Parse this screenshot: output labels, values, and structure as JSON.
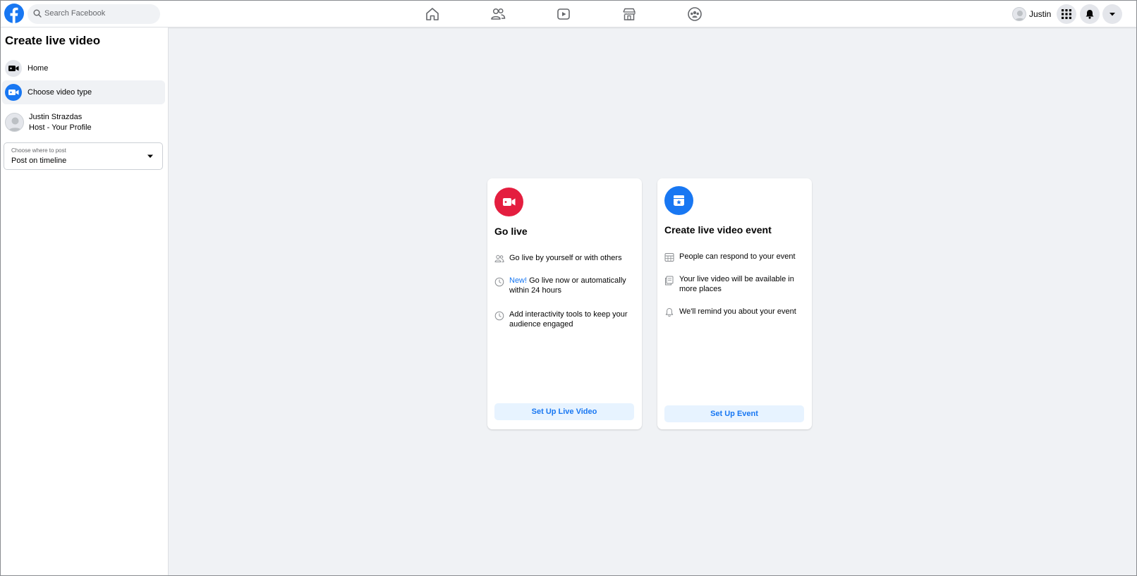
{
  "topbar": {
    "logo_icon": "facebook-logo",
    "search_placeholder": "Search Facebook",
    "nav_icons": [
      "home-icon",
      "friends-icon",
      "watch-icon",
      "marketplace-icon",
      "groups-icon"
    ],
    "user_name": "Justin",
    "right_icons": [
      "menu-grid-icon",
      "notifications-icon",
      "account-caret-icon"
    ]
  },
  "sidebar": {
    "title": "Create live video",
    "items": [
      {
        "label": "Home",
        "icon": "video-camera-icon"
      },
      {
        "label": "Choose video type",
        "icon": "video-camera-icon"
      }
    ],
    "host": {
      "name": "Justin Strazdas",
      "role": "Host - Your Profile"
    },
    "post_where": {
      "label": "Choose where to post",
      "value": "Post on timeline"
    }
  },
  "cards": {
    "golive": {
      "title": "Go live",
      "icon": "live-camera-icon",
      "features": [
        {
          "text": "Go live by yourself or with others",
          "icon": "people-icon"
        },
        {
          "new": "New!",
          "text": " Go live now or automatically within 24 hours",
          "icon": "clock-icon"
        },
        {
          "text": "Add interactivity tools to keep your audience engaged",
          "icon": "clock-icon"
        }
      ],
      "button": "Set Up Live Video"
    },
    "event": {
      "title": "Create live video event",
      "icon": "calendar-star-icon",
      "features": [
        {
          "text": "People can respond to your event",
          "icon": "calendar-grid-icon"
        },
        {
          "text": "Your live video will be available in more places",
          "icon": "pages-icon"
        },
        {
          "text": "We'll remind you about your event",
          "icon": "bell-icon"
        }
      ],
      "button": "Set Up Event"
    }
  },
  "colors": {
    "brand_blue": "#1877f2",
    "live_red": "#e41e3f",
    "bg": "#f0f2f5",
    "button_bg": "#e7f3ff"
  }
}
